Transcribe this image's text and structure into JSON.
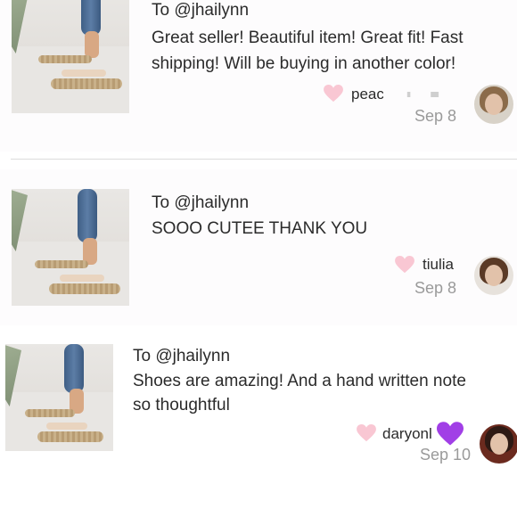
{
  "reviews": [
    {
      "to": "To @jhailynn",
      "lines": [
        "Great seller! Beautiful item! Great fit! Fast",
        "shipping! Will be buying in another color!"
      ],
      "username": "peac",
      "date": "Sep 8"
    },
    {
      "to": "To @jhailynn",
      "lines": [
        "SOOO CUTEE THANK YOU"
      ],
      "username": "tiulia",
      "date": "Sep 8"
    },
    {
      "to": "To @jhailynn",
      "lines": [
        "Shoes are amazing! And a hand written note",
        "so thoughtful"
      ],
      "username": "daryonl",
      "date": "Sep 10"
    }
  ],
  "colors": {
    "heart_pink": "#f9c7d3",
    "date_gray": "#9a9a9a",
    "purple_heart": "#a13fe6"
  },
  "icons": [
    "heart-icon",
    "purple-heart-emoji"
  ]
}
